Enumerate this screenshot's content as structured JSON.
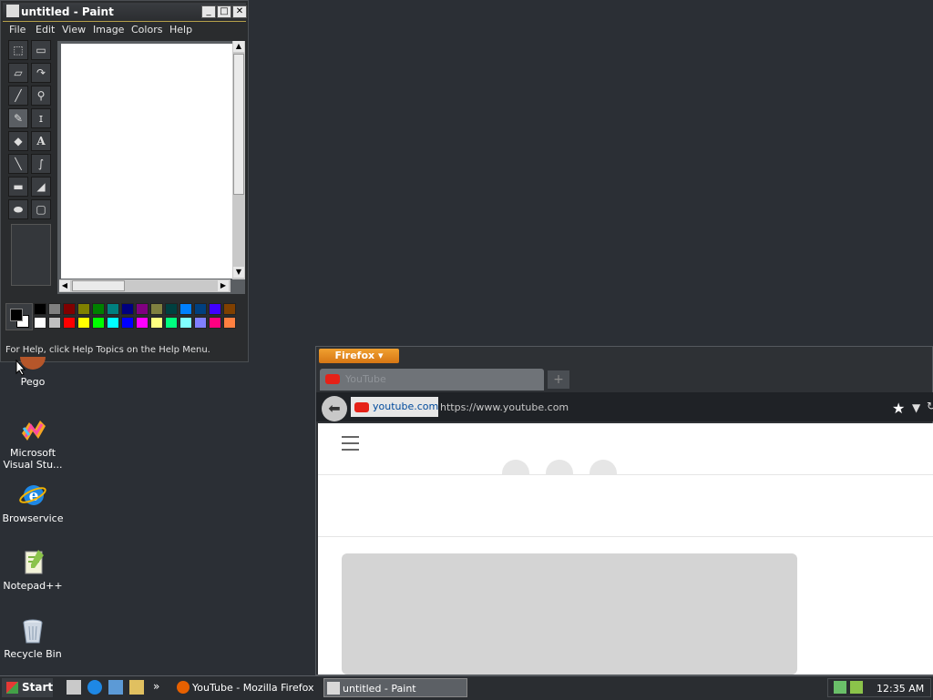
{
  "paint": {
    "title": "untitled - Paint",
    "menu": [
      "File",
      "Edit",
      "View",
      "Image",
      "Colors",
      "Help"
    ],
    "status": "For Help, click Help Topics on the Help Menu.",
    "palette_top": [
      "#000000",
      "#808080",
      "#800000",
      "#808000",
      "#008000",
      "#008080",
      "#000080",
      "#800080",
      "#808040",
      "#004040",
      "#0080ff",
      "#004080",
      "#4000ff",
      "#804000"
    ],
    "palette_bottom": [
      "#ffffff",
      "#c0c0c0",
      "#ff0000",
      "#ffff00",
      "#00ff00",
      "#00ffff",
      "#0000ff",
      "#ff00ff",
      "#ffff80",
      "#00ff80",
      "#80ffff",
      "#8080ff",
      "#ff0080",
      "#ff8040"
    ],
    "tools": [
      "free-select-icon",
      "rect-select-icon",
      "eraser-icon",
      "fill-icon",
      "color-picker-icon",
      "magnifier-icon",
      "pencil-icon",
      "brush-icon",
      "airbrush-icon",
      "text-icon",
      "line-icon",
      "curve-icon",
      "rectangle-icon",
      "polygon-icon",
      "ellipse-icon",
      "rounded-rect-icon"
    ]
  },
  "desktop": {
    "icons": [
      {
        "label": "Pego"
      },
      {
        "label": "Microsoft Visual Stu..."
      },
      {
        "label": "Browservice"
      },
      {
        "label": "Notepad++"
      },
      {
        "label": "Recycle Bin"
      }
    ]
  },
  "firefox": {
    "menu_button": "Firefox",
    "tab_title": "YouTube",
    "identity": "youtube.com",
    "url": "https://www.youtube.com"
  },
  "taskbar": {
    "start": "Start",
    "tasks": [
      "YouTube - Mozilla Firefox",
      "untitled - Paint"
    ],
    "time": "12:35 AM"
  },
  "colors": {
    "accent": "#d67614",
    "paint_title_border": "#b5a04a"
  }
}
